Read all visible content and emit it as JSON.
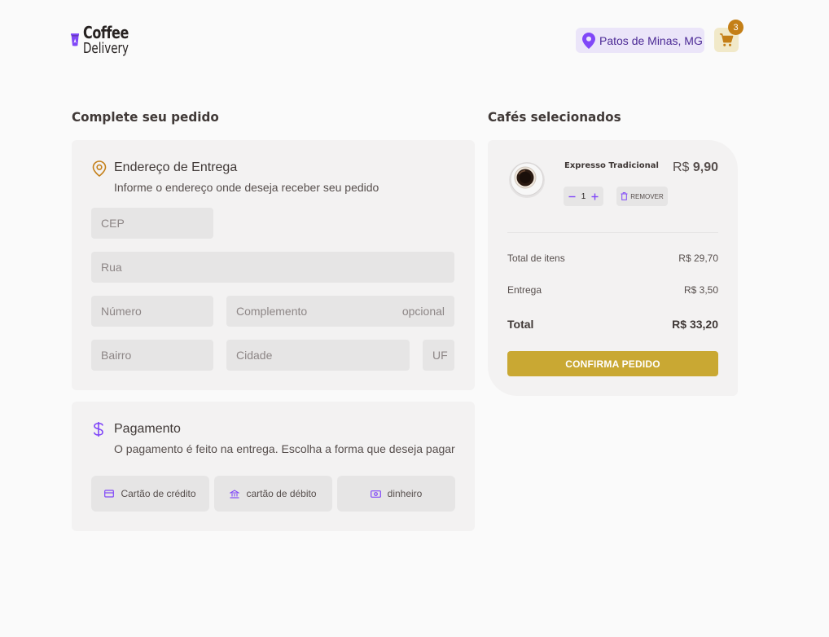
{
  "header": {
    "logo": {
      "line1": "Coffee",
      "line2": "Delivery"
    },
    "location": "Patos de Minas, MG",
    "cart_count": "3"
  },
  "order": {
    "title": "Complete seu pedido",
    "address": {
      "title": "Endereço de Entrega",
      "subtitle": "Informe o endereço onde deseja receber seu pedido",
      "fields": {
        "cep": "CEP",
        "rua": "Rua",
        "numero": "Número",
        "complemento": "Complemento",
        "complemento_optional": "opcional",
        "bairro": "Bairro",
        "cidade": "Cidade",
        "uf": "UF"
      }
    },
    "payment": {
      "title": "Pagamento",
      "subtitle": "O pagamento é feito na entrega. Escolha a forma que deseja pagar",
      "options": [
        "Cartão de crédito",
        "cartão de débito",
        "dinheiro"
      ]
    }
  },
  "cart": {
    "title": "Cafés selecionados",
    "items": [
      {
        "name": "Expresso Tradicional",
        "currency": "R$",
        "price": "9,90",
        "quantity": "1",
        "remove_label": "REMOVER"
      }
    ],
    "summary": {
      "items_label": "Total de itens",
      "items_value": "R$ 29,70",
      "delivery_label": "Entrega",
      "delivery_value": "R$ 3,50",
      "total_label": "Total",
      "total_value": "R$ 33,20"
    },
    "confirm_label": "CONFIRMA PEDIDO"
  },
  "colors": {
    "purple": "#8047f8",
    "purple_dark": "#4b2995",
    "purple_light": "#ebe5f9",
    "yellow": "#c9a833",
    "yellow_dark": "#c47f17",
    "yellow_light": "#f1e9c9"
  },
  "icons": [
    "coffee-cup-logo-icon",
    "map-pin-icon",
    "shopping-cart-icon",
    "map-pin-outline-icon",
    "currency-dollar-icon",
    "credit-card-icon",
    "bank-icon",
    "money-icon",
    "minus-icon",
    "plus-icon",
    "trash-icon"
  ]
}
